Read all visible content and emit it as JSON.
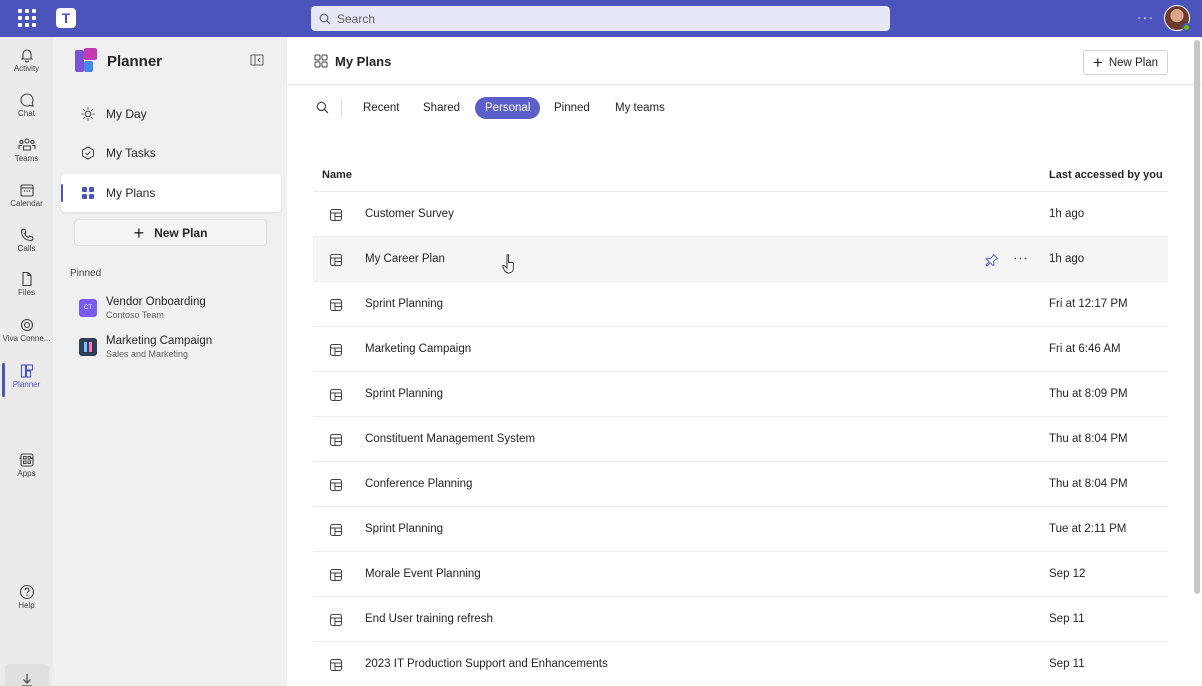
{
  "topbar": {
    "search_placeholder": "Search",
    "more": "···"
  },
  "rail": {
    "items": [
      {
        "label": "Activity",
        "icon": "bell-icon"
      },
      {
        "label": "Chat",
        "icon": "chat-icon"
      },
      {
        "label": "Teams",
        "icon": "teams-icon"
      },
      {
        "label": "Calendar",
        "icon": "calendar-icon"
      },
      {
        "label": "Calls",
        "icon": "phone-icon"
      },
      {
        "label": "Files",
        "icon": "file-icon"
      },
      {
        "label": "Viva Conne...",
        "icon": "viva-icon"
      },
      {
        "label": "Planner",
        "icon": "planner-icon"
      },
      {
        "label": "Apps",
        "icon": "apps-icon"
      },
      {
        "label": "Help",
        "icon": "help-icon"
      }
    ],
    "more": "···"
  },
  "sidebar": {
    "title": "Planner",
    "nav": [
      {
        "label": "My Day",
        "icon": "sun-icon"
      },
      {
        "label": "My Tasks",
        "icon": "task-check-icon"
      },
      {
        "label": "My Plans",
        "icon": "grid-icon"
      }
    ],
    "new_plan": "New Plan",
    "pinned_label": "Pinned",
    "pinned": [
      {
        "name": "Vendor Onboarding",
        "sub": "Contoso Team",
        "initials": "CT",
        "color": "#7b5cf0"
      },
      {
        "name": "Marketing Campaign",
        "sub": "Sales and Marketing",
        "initials": "",
        "color": "#2f3e58"
      }
    ]
  },
  "main": {
    "title": "My Plans",
    "new_plan": "New Plan",
    "filters": [
      "Recent",
      "Shared",
      "Personal",
      "Pinned",
      "My teams"
    ],
    "active_filter": "Personal",
    "columns": {
      "name": "Name",
      "last": "Last accessed by you"
    },
    "rows": [
      {
        "name": "Customer Survey",
        "time": "1h ago"
      },
      {
        "name": "My Career Plan",
        "time": "1h ago"
      },
      {
        "name": "Sprint Planning",
        "time": "Fri at 12:17 PM"
      },
      {
        "name": "Marketing Campaign",
        "time": "Fri at 6:46 AM"
      },
      {
        "name": "Sprint Planning",
        "time": "Thu at 8:09 PM"
      },
      {
        "name": "Constituent Management System",
        "time": "Thu at 8:04 PM"
      },
      {
        "name": "Conference Planning",
        "time": "Thu at 8:04 PM"
      },
      {
        "name": "Sprint Planning",
        "time": "Tue at 2:11 PM"
      },
      {
        "name": "Morale Event Planning",
        "time": "Sep 12"
      },
      {
        "name": "End User training refresh",
        "time": "Sep 11"
      },
      {
        "name": "2023 IT Production Support and Enhancements",
        "time": "Sep 11"
      }
    ],
    "row_more": "···"
  },
  "colors": {
    "brand": "#4b53bc",
    "pill_active": "#5b5fc7"
  }
}
